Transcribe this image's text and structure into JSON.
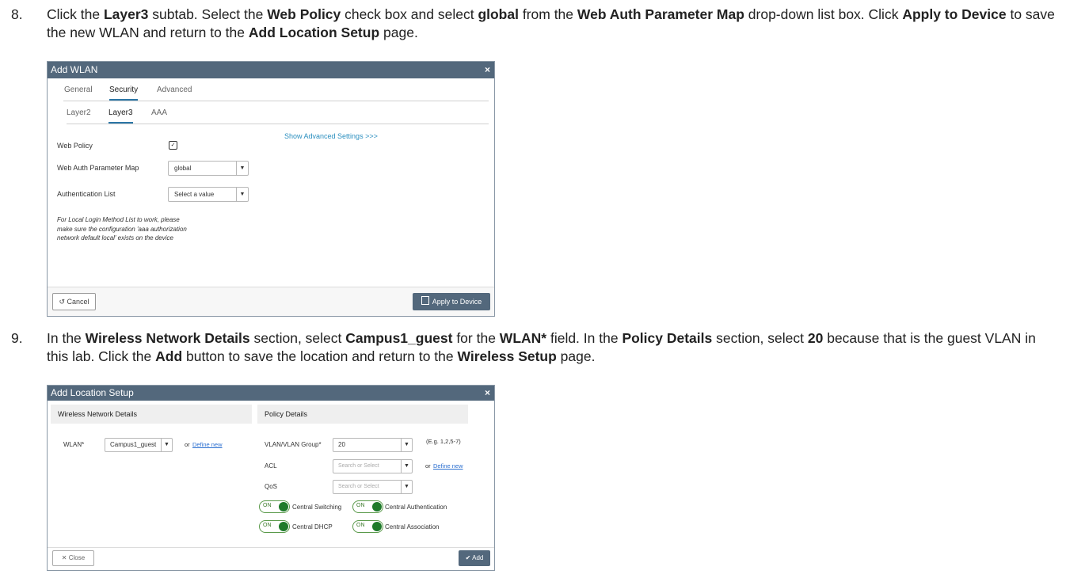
{
  "step8": {
    "num": "8.",
    "parts": [
      "Click the ",
      "Layer3",
      " subtab. Select the ",
      "Web Policy",
      " check box and select ",
      "global",
      " from the ",
      "Web Auth Parameter Map",
      " drop-down list box. Click ",
      "Apply to Device",
      " to save the new WLAN and return to the ",
      "Add Location Setup",
      " page."
    ]
  },
  "add_wlan": {
    "title": "Add WLAN",
    "close": "×",
    "tabs": [
      "General",
      "Security",
      "Advanced"
    ],
    "subtabs": [
      "Layer2",
      "Layer3",
      "AAA"
    ],
    "advanced_link": "Show Advanced Settings >>>",
    "web_policy_label": "Web Policy",
    "web_policy_checked": "✓",
    "web_auth_label": "Web Auth Parameter Map",
    "web_auth_value": "global",
    "auth_list_label": "Authentication List",
    "auth_list_value": "Select a value",
    "note_lines": [
      "For Local Login Method List to work, please",
      "make sure the configuration 'aaa authorization",
      "network default local' exists on the device"
    ],
    "cancel": "Cancel",
    "apply": "Apply to Device"
  },
  "step9": {
    "num": "9.",
    "parts": [
      "In the ",
      "Wireless Network Details",
      " section, select ",
      "Campus1_guest",
      " for the ",
      "WLAN*",
      " field. In the ",
      "Policy Details",
      " section, select ",
      "20",
      " because that is the guest VLAN in this lab. Click the ",
      "Add",
      " button to save the location and return to the ",
      "Wireless Setup",
      " page."
    ]
  },
  "add_location": {
    "title": "Add Location Setup",
    "close": "×",
    "wnd_header": "Wireless Network Details",
    "pd_header": "Policy Details",
    "wlan_label": "WLAN*",
    "wlan_value": "Campus1_guest",
    "define_new": "Define new",
    "or": "or",
    "vlan_label": "VLAN/VLAN Group*",
    "vlan_value": "20",
    "vlan_hint": "(E.g. 1,2,5-7)",
    "acl_label": "ACL",
    "qos_label": "QoS",
    "search_placeholder": "Search or Select",
    "toggles": [
      {
        "state": "ON",
        "label": "Central Switching"
      },
      {
        "state": "ON",
        "label": "Central Authentication"
      },
      {
        "state": "ON",
        "label": "Central DHCP"
      },
      {
        "state": "ON",
        "label": "Central Association"
      }
    ],
    "close_btn": "Close",
    "add_btn": "Add"
  }
}
